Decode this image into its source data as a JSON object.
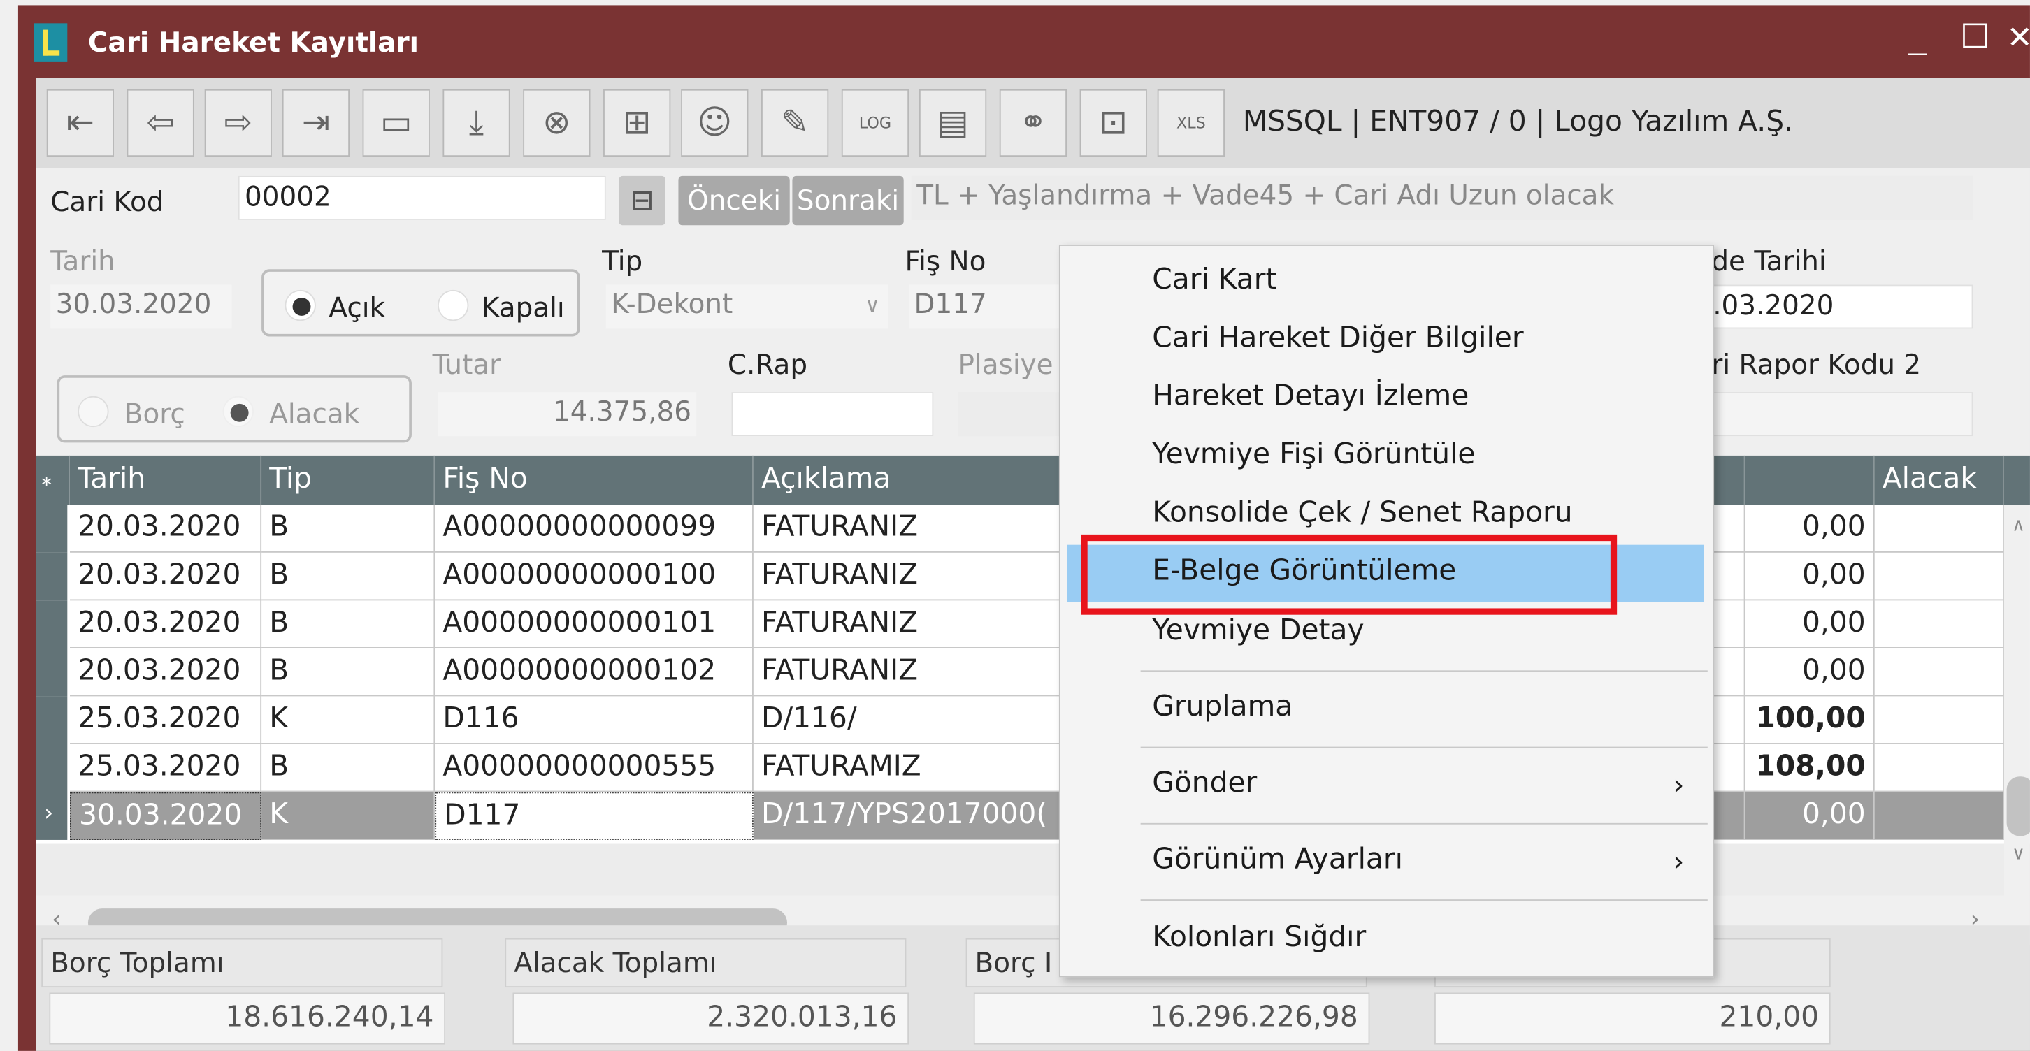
{
  "window": {
    "title": "Cari Hareket Kayıtları",
    "minimize": "_",
    "maximize": "☐",
    "close": "✕"
  },
  "toolbar": {
    "icons": [
      "first-icon",
      "prev-icon",
      "next-icon",
      "last-icon",
      "document-icon",
      "download-icon",
      "cancel-icon",
      "new-folder-icon",
      "user-icon",
      "edit-icon",
      "log-icon",
      "document-settings-icon",
      "link-icon",
      "lock-icon",
      "excel-icon"
    ],
    "connection": "MSSQL | ENT907 / 0 | Logo Yazılım A.Ş."
  },
  "filter": {
    "cari_kod_label": "Cari Kod",
    "cari_kod_value": "00002",
    "prev_button": "Önceki",
    "next_button": "Sonraki",
    "description": "TL + Yaşlandırma + Vade45 + Cari Adı Uzun olacak",
    "tarih_label": "Tarih",
    "tarih_value": "30.03.2020",
    "acik_label": "Açık",
    "kapali_label": "Kapalı",
    "tip_label": "Tip",
    "tip_value": "K-Dekont",
    "fisno_label": "Fiş No",
    "fisno_value": "D117",
    "vade_label": "de Tarihi",
    "vade_value": ".03.2020",
    "borc_label": "Borç",
    "alacak_label": "Alacak",
    "tutar_label": "Tutar",
    "tutar_value": "14.375,86",
    "crap_label": "C.Rap",
    "plasiyer_label": "Plasiye",
    "rapor2_label": "ri Rapor Kodu 2"
  },
  "grid": {
    "headers": {
      "tarih": "Tarih",
      "tip": "Tip",
      "fisno": "Fiş No",
      "aciklama": "Açıklama",
      "alacak": "Alacak"
    },
    "rows": [
      {
        "tarih": "20.03.2020",
        "tip": "B",
        "fisno": "A00000000000099",
        "aciklama": "FATURANIZ",
        "borc": "0,00"
      },
      {
        "tarih": "20.03.2020",
        "tip": "B",
        "fisno": "A00000000000100",
        "aciklama": "FATURANIZ",
        "borc": "0,00"
      },
      {
        "tarih": "20.03.2020",
        "tip": "B",
        "fisno": "A00000000000101",
        "aciklama": "FATURANIZ",
        "borc": "0,00"
      },
      {
        "tarih": "20.03.2020",
        "tip": "B",
        "fisno": "A00000000000102",
        "aciklama": "FATURANIZ",
        "borc": "0,00"
      },
      {
        "tarih": "25.03.2020",
        "tip": "K",
        "fisno": "D116",
        "aciklama": "D/116/",
        "borc": "100,00"
      },
      {
        "tarih": "25.03.2020",
        "tip": "B",
        "fisno": "A00000000000555",
        "aciklama": "FATURAMIZ",
        "borc": "108,00"
      },
      {
        "tarih": "30.03.2020",
        "tip": "K",
        "fisno": "D117",
        "aciklama": "D/117/YPS2017000(",
        "borc": "0,00"
      }
    ]
  },
  "totals": {
    "borc_label": "Borç Toplamı",
    "borc_value": "18.616.240,14",
    "alacak_label": "Alacak Toplamı",
    "alacak_value": "2.320.013,16",
    "bakiye_label": "Borç I",
    "bakiye_value": "16.296.226,98",
    "other_value": "210,00"
  },
  "context_menu": {
    "items": [
      "Cari Kart",
      "Cari Hareket Diğer Bilgiler",
      "Hareket Detayı İzleme",
      "Yevmiye Fişi Görüntüle",
      "Konsolide Çek / Senet Raporu",
      "E-Belge Görüntüleme",
      "Yevmiye Detay",
      "Gruplama",
      "Gönder",
      "Görünüm Ayarları",
      "Kolonları Sığdır"
    ],
    "highlighted": "E-Belge Görüntüleme"
  },
  "colors": {
    "title_bar": "#7a3333",
    "grid_header": "#627377",
    "menu_highlight": "#99ccf3",
    "annotation_box": "#e8141c"
  }
}
